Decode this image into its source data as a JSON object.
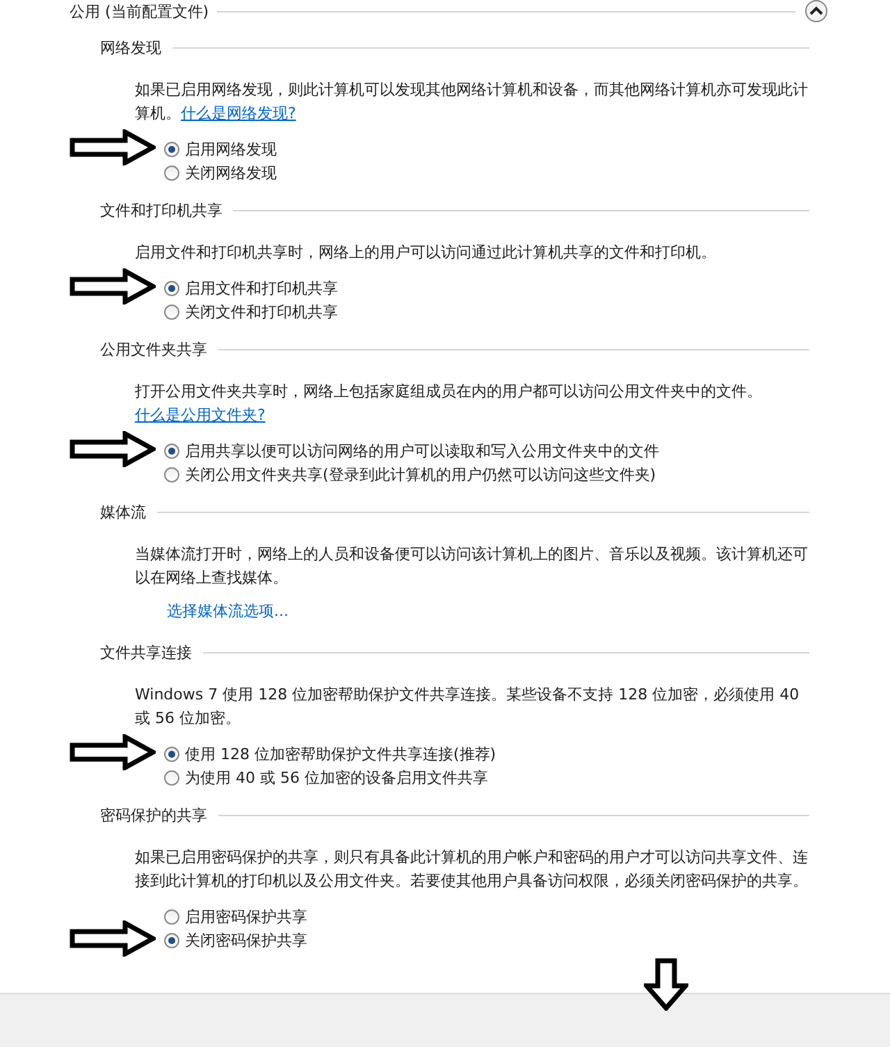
{
  "group": {
    "title": "公用 (当前配置文件)",
    "expanded": true
  },
  "sections": [
    {
      "title": "网络发现",
      "description": "如果已启用网络发现，则此计算机可以发现其他网络计算机和设备，而其他网络计算机亦可发现此计算机。",
      "help_link": "什么是网络发现?",
      "options": [
        {
          "label": "启用网络发现",
          "selected": true,
          "marked": true
        },
        {
          "label": "关闭网络发现",
          "selected": false,
          "marked": false
        }
      ]
    },
    {
      "title": "文件和打印机共享",
      "description": "启用文件和打印机共享时，网络上的用户可以访问通过此计算机共享的文件和打印机。",
      "options": [
        {
          "label": "启用文件和打印机共享",
          "selected": true,
          "marked": true
        },
        {
          "label": "关闭文件和打印机共享",
          "selected": false,
          "marked": false
        }
      ]
    },
    {
      "title": "公用文件夹共享",
      "description": "打开公用文件夹共享时，网络上包括家庭组成员在内的用户都可以访问公用文件夹中的文件。",
      "help_link": "什么是公用文件夹?",
      "options": [
        {
          "label": "启用共享以便可以访问网络的用户可以读取和写入公用文件夹中的文件",
          "selected": true,
          "marked": true
        },
        {
          "label": "关闭公用文件夹共享(登录到此计算机的用户仍然可以访问这些文件夹)",
          "selected": false,
          "marked": false
        }
      ]
    },
    {
      "title": "媒体流",
      "description": "当媒体流打开时，网络上的人员和设备便可以访问该计算机上的图片、音乐以及视频。该计算机还可以在网络上查找媒体。",
      "action_link": "选择媒体流选项..."
    },
    {
      "title": "文件共享连接",
      "description": "Windows 7 使用 128 位加密帮助保护文件共享连接。某些设备不支持 128 位加密，必须使用 40 或 56 位加密。",
      "options": [
        {
          "label": "使用 128 位加密帮助保护文件共享连接(推荐)",
          "selected": true,
          "marked": true
        },
        {
          "label": "为使用 40 或 56 位加密的设备启用文件共享",
          "selected": false,
          "marked": false
        }
      ]
    },
    {
      "title": "密码保护的共享",
      "description": "如果已启用密码保护的共享，则只有具备此计算机的用户帐户和密码的用户才可以访问共享文件、连接到此计算机的打印机以及公用文件夹。若要使其他用户具备访问权限，必须关闭密码保护的共享。",
      "options": [
        {
          "label": "启用密码保护共享",
          "selected": false,
          "marked": false
        },
        {
          "label": "关闭密码保护共享",
          "selected": true,
          "marked": true
        }
      ]
    }
  ],
  "footer": {
    "down_arrow": true
  }
}
